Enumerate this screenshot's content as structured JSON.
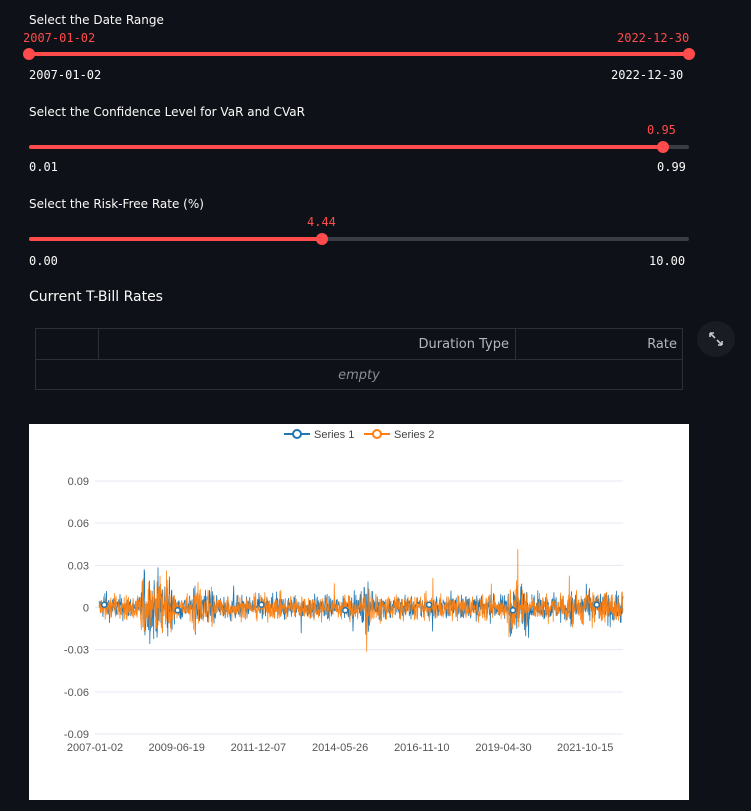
{
  "date_slider": {
    "label": "Select the Date Range",
    "value_low": "2007-01-02",
    "value_high": "2022-12-30",
    "min": "2007-01-02",
    "max": "2022-12-30"
  },
  "conf_slider": {
    "label": "Select the Confidence Level for VaR and CVaR",
    "value": "0.95",
    "min": "0.01",
    "max": "0.99",
    "fraction": 0.96
  },
  "rf_slider": {
    "label": "Select the Risk-Free Rate (%)",
    "value": "4.44",
    "min": "0.00",
    "max": "10.00",
    "fraction": 0.444
  },
  "tbill": {
    "heading": "Current T-Bill Rates",
    "columns": [
      "Duration Type",
      "Rate"
    ],
    "empty_text": "empty",
    "expand_icon": "expand-icon"
  },
  "colors": {
    "accent": "#ff4b4b",
    "background": "#0e1117",
    "series1": "#1f77b4",
    "series2": "#ff7f0e"
  },
  "chart_data": {
    "type": "line",
    "series": [
      {
        "name": "Series 1"
      },
      {
        "name": "Series 2"
      }
    ],
    "x_ticks": [
      "2007-01-02",
      "2009-06-19",
      "2011-12-07",
      "2014-05-26",
      "2016-11-10",
      "2019-04-30",
      "2021-10-15"
    ],
    "y_ticks": [
      "0.09",
      "0.06",
      "0.03",
      "0",
      "-0.03",
      "-0.06",
      "-0.09"
    ],
    "y_tick_values": [
      0.09,
      0.06,
      0.03,
      0,
      -0.03,
      -0.06,
      -0.09
    ],
    "ylim": [
      -0.09,
      0.09
    ],
    "xlim": [
      "2007-01-02",
      "2022-12-30"
    ],
    "legend_position": "top-center",
    "grid": true
  }
}
